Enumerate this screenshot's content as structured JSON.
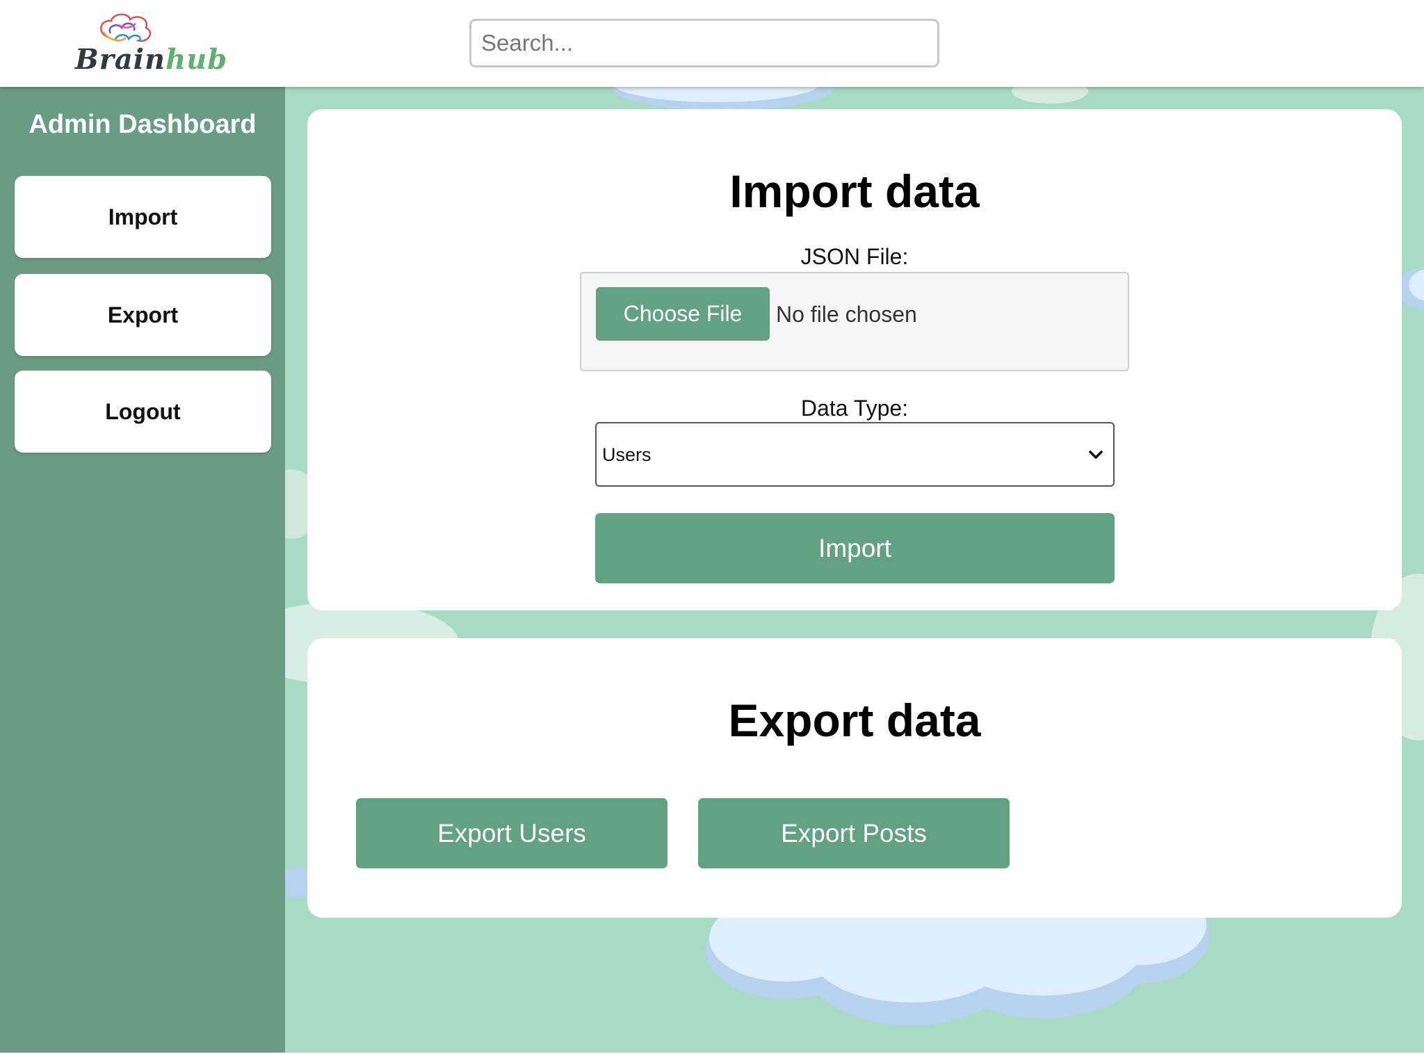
{
  "header": {
    "logo_part1": "Brain",
    "logo_part2": "hub",
    "search_placeholder": "Search..."
  },
  "sidebar": {
    "title": "Admin Dashboard",
    "items": [
      {
        "label": "Import"
      },
      {
        "label": "Export"
      },
      {
        "label": "Logout"
      }
    ]
  },
  "import_section": {
    "title": "Import data",
    "file_label": "JSON File:",
    "choose_file_label": "Choose File",
    "no_file_text": "No file chosen",
    "data_type_label": "Data Type:",
    "data_type_value": "Users",
    "import_button": "Import"
  },
  "export_section": {
    "title": "Export data",
    "export_users_button": "Export Users",
    "export_posts_button": "Export Posts"
  },
  "colors": {
    "accent_green": "#62a283",
    "sidebar_green": "#6a9c83",
    "background_mint": "#a7dbc4",
    "cloud_blue": "#b8d4f0"
  }
}
